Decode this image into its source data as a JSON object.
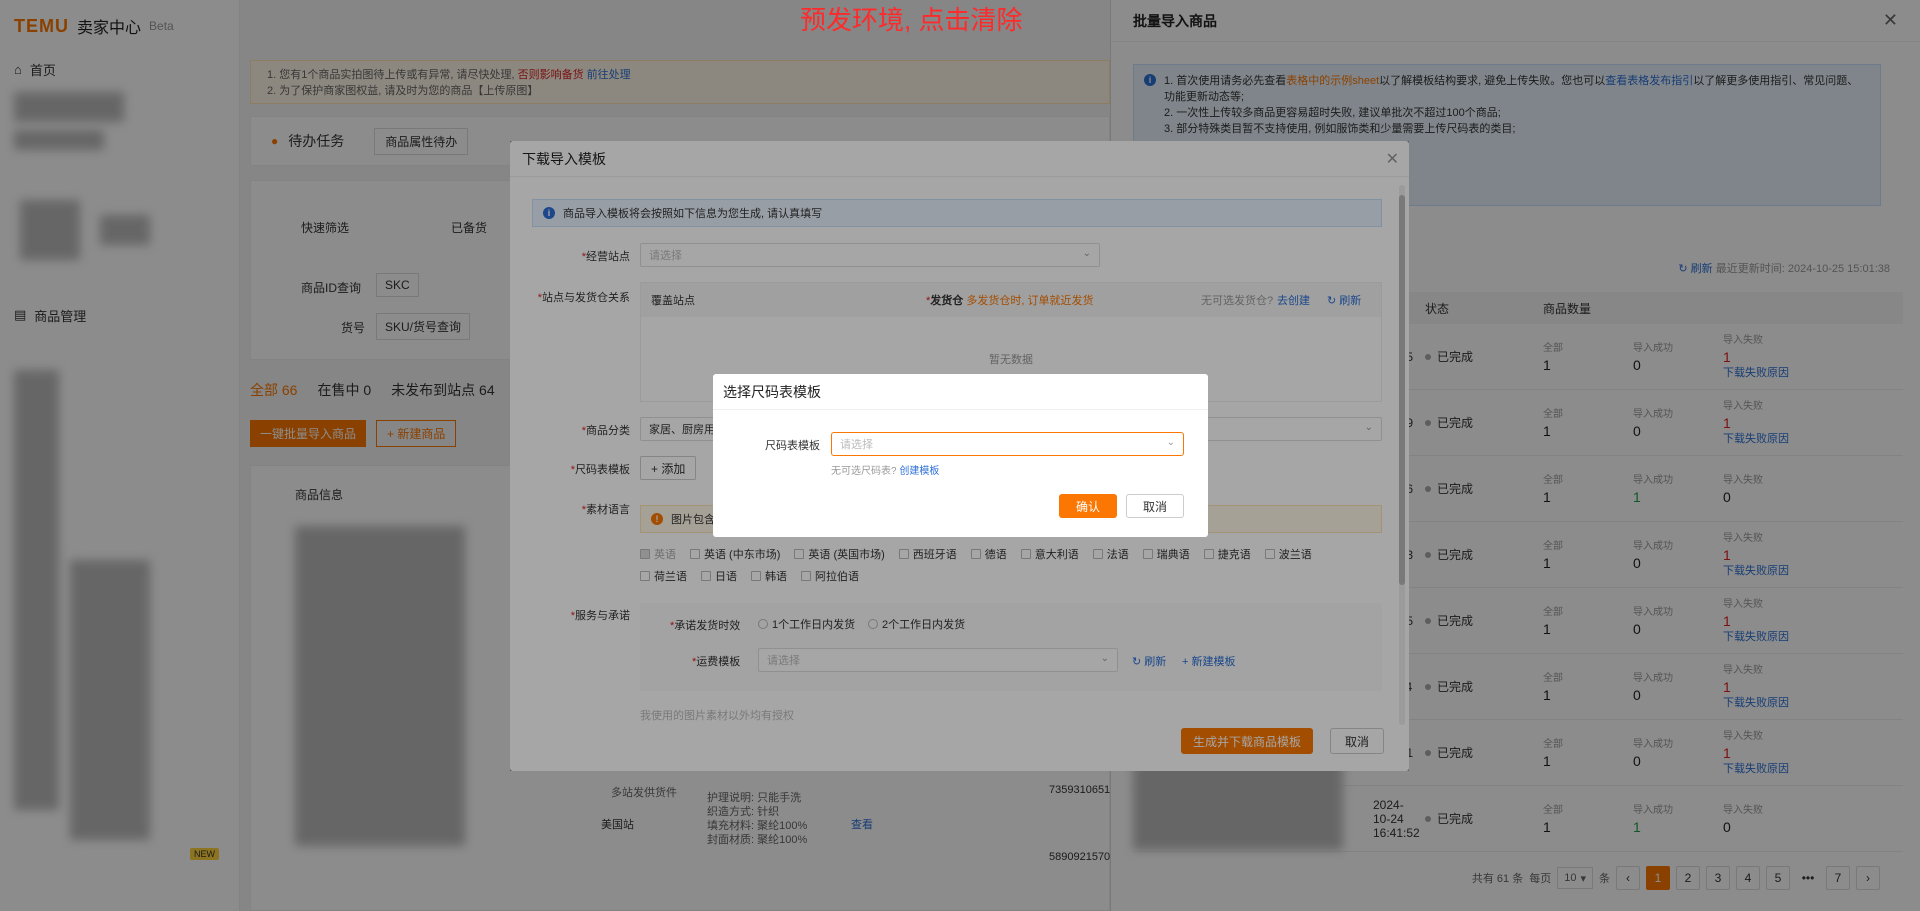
{
  "banner": "预发环境, 点击清除",
  "brand": {
    "logo": "TEMU",
    "title": "卖家中心",
    "beta": "Beta"
  },
  "sidebar": {
    "home": "首页",
    "goods_mgmt": "商品管理",
    "new_badge": "NEW"
  },
  "main": {
    "notice_line1": "1. 您有1个商品实拍图待上传或有异常, 请尽快处理,",
    "notice_link1": "否则影响备货",
    "notice_link1b": "前往处理",
    "notice_line2": "2. 为了保护商家图权益, 请及时为您的商品【上传原图】",
    "pending_task": "待办任务",
    "attr_pending": "商品属性待办",
    "tabs": [
      "全部 66",
      "在售中 0",
      "未发布到站点 64"
    ],
    "fast_filter": "快速筛选",
    "in_stock_select": "已备货",
    "product_search": "商品ID查询",
    "skc": "SKC",
    "goods_no": "货号",
    "sku_search": "SKU/货号查询",
    "btn_batch": "一键批量导入商品",
    "btn_new": "+ 新建商品",
    "goods_info": "商品信息",
    "sample_text": "美国站",
    "care_lines": [
      "护理说明: 只能手洗",
      "织造方式: 针织",
      "填充材料: 聚纶100%",
      "封面材质: 聚纶100%"
    ],
    "view": "查看",
    "id1": "7359310651",
    "id2": "5890921570",
    "extra": "多站发供货件"
  },
  "drawer": {
    "title": "批量导入商品",
    "info_lines": [
      {
        "pre": "1. 首次使用请务必先查看",
        "hl": "表格中的示例sheet",
        "mid": "以了解模板结构要求, 避免上传失败。您也可以",
        "ln": "查看表格发布指引",
        "post": "以了解更多使用指引、常见问题、功能更新动态等;"
      },
      {
        "pre": "2. 一次性上传较多商品更容易超时失败, 建议单批次不超过100个商品;",
        "hl": "",
        "mid": "",
        "ln": "",
        "post": ""
      },
      {
        "pre": "3. 部分特殊类目暂不支持使用, 例如服饰类和少量需要上传尺码表的类目;",
        "hl": "",
        "mid": "",
        "ln": "",
        "post": ""
      }
    ],
    "refresh": "刷新",
    "last_update": "最近更新时间: 2024-10-25 15:01:38",
    "col_status": "状态",
    "col_qty": "商品数量",
    "label_all": "全部",
    "label_ok": "导入成功",
    "label_fail": "导入失败",
    "dl_fail": "下载失败原因",
    "rows": [
      {
        "time": "7:26:15",
        "status": "已完成",
        "all": "1",
        "ok": "0",
        "fail": "1",
        "ok_green": false,
        "has_dl": true
      },
      {
        "time": "7:25:49",
        "status": "已完成",
        "all": "1",
        "ok": "0",
        "fail": "1",
        "ok_green": false,
        "has_dl": true
      },
      {
        "time": "7:13:16",
        "status": "已完成",
        "all": "1",
        "ok": "1",
        "fail": "0",
        "ok_green": true,
        "has_dl": false
      },
      {
        "time": "7:12:33",
        "status": "已完成",
        "all": "1",
        "ok": "0",
        "fail": "1",
        "ok_green": false,
        "has_dl": true
      },
      {
        "time": "7:12:15",
        "status": "已完成",
        "all": "1",
        "ok": "0",
        "fail": "1",
        "ok_green": false,
        "has_dl": true
      },
      {
        "time": "7:11:54",
        "status": "已完成",
        "all": "1",
        "ok": "0",
        "fail": "1",
        "ok_green": false,
        "has_dl": true
      },
      {
        "time": "6:44:41",
        "status": "已完成",
        "all": "1",
        "ok": "0",
        "fail": "1",
        "ok_green": false,
        "has_dl": true
      },
      {
        "time": "2024-10-24 16:41:52",
        "status": "已完成",
        "all": "1",
        "ok": "1",
        "fail": "0",
        "ok_green": true,
        "has_dl": false
      }
    ],
    "pager": {
      "total": "共有 61 条",
      "per": "每页",
      "size": "10",
      "unit": "条",
      "pages": [
        "1",
        "2",
        "3",
        "4",
        "5",
        "•••",
        "7"
      ],
      "current": "1"
    }
  },
  "dl_modal": {
    "title": "下载导入模板",
    "tip": "商品导入模板将会按照如下信息为您生成, 请认真填写",
    "site_label": "经营站点",
    "placeholder": "请选择",
    "rel_label": "站点与发货仓关系",
    "cover_site": "覆盖站点",
    "ship_wh": "发货仓",
    "ship_wh_hint": "多发货仓时, 订单就近发货",
    "no_wh": "无可选发货仓?",
    "go_create": "去创建",
    "refresh": "刷新",
    "empty": "暂无数据",
    "cat_label": "商品分类",
    "cat_value": "家居、厨房用品",
    "size_label": "尺码表模板",
    "add": "+ 添加",
    "lang_label": "素材语言",
    "warn": "图片包含",
    "langs_row1": [
      "英语",
      "英语 (中东市场)",
      "英语 (英国市场)",
      "西班牙语",
      "德语",
      "意大利语",
      "法语",
      "瑞典语",
      "捷克语",
      "波兰语"
    ],
    "langs_row2": [
      "荷兰语",
      "日语",
      "韩语",
      "阿拉伯语"
    ],
    "svc_label": "服务与承诺",
    "ship_time_label": "承诺发货时效",
    "ship_opt1": "1个工作日内发货",
    "ship_opt2": "2个工作日内发货",
    "freight_label": "运费模板",
    "new_template": "+ 新建模板",
    "footer_note": "我使用的图片素材以外均有授权",
    "gen_btn": "生成并下载商品模板",
    "cancel": "取消"
  },
  "size_modal": {
    "title": "选择尺码表模板",
    "label": "尺码表模板",
    "placeholder": "请选择",
    "hint": "无可选尺码表?",
    "create": "创建模板",
    "ok": "确认",
    "cancel": "取消"
  }
}
